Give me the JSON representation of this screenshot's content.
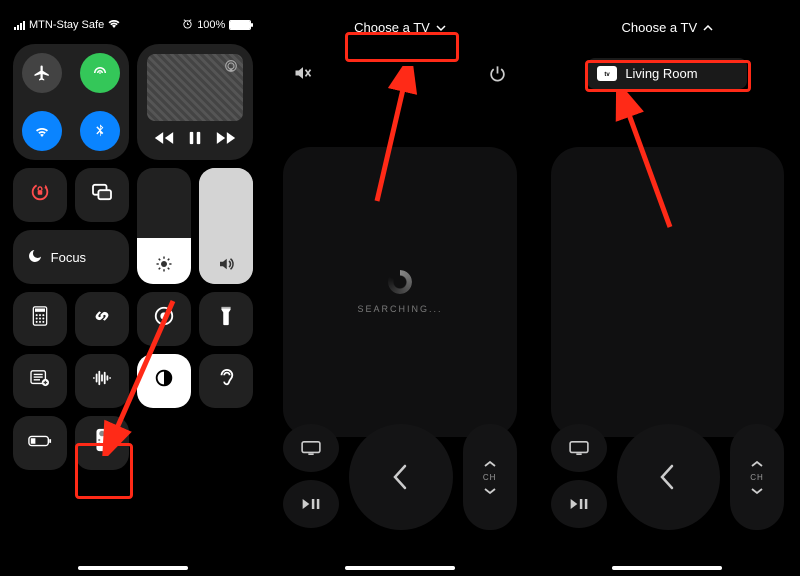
{
  "status": {
    "carrier": "MTN-Stay Safe",
    "battery_pct": "100%"
  },
  "connectivity": {
    "airplane": "airplane-icon",
    "cellular": "cellular-icon",
    "wifi": "wifi-icon",
    "bluetooth": "bluetooth-icon"
  },
  "media": {
    "rewind": "⏪",
    "pause": "| |",
    "forward": "⏩"
  },
  "focus_label": "Focus",
  "choose_tv_label": "Choose a TV",
  "searching_label": "SEARCHING...",
  "channel_label": "CH",
  "tv_option": {
    "icon": "▶tv",
    "name": "Living Room"
  },
  "tiles": {
    "orientation_lock": "orientation-lock-icon",
    "screen_mirroring": "screen-mirroring-icon",
    "brightness": "sun-icon",
    "volume": "speaker-icon",
    "calculator": "calculator-icon",
    "shazam": "shazam-icon",
    "screen_record": "record-icon",
    "flashlight": "flashlight-icon",
    "notes": "notes-icon",
    "sound_recognition": "sound-recognition-icon",
    "dark_mode": "dark-mode-icon",
    "hearing": "hearing-icon",
    "low_power": "low-power-icon",
    "apple_tv_remote": "apple-tv-remote-icon"
  },
  "remote_buttons": {
    "mute": "mute-icon",
    "power": "power-icon",
    "tv_app": "tv-app-icon",
    "play_pause": "play-pause-icon",
    "back": "back-icon",
    "ch_up": "chevron-up-icon",
    "ch_down": "chevron-down-icon"
  }
}
